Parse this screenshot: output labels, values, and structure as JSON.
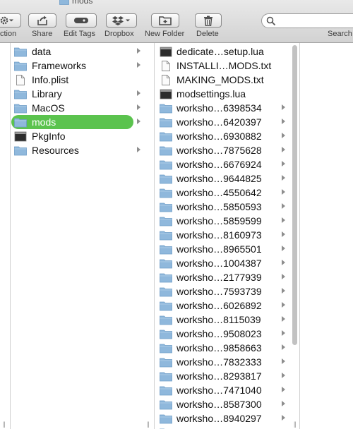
{
  "window": {
    "title": "mods"
  },
  "toolbar": {
    "action_label": "ction",
    "share_label": "Share",
    "edit_tags_label": "Edit Tags",
    "dropbox_label": "Dropbox",
    "new_folder_label": "New Folder",
    "delete_label": "Delete",
    "search_label": "Search",
    "search_placeholder": ""
  },
  "column2": {
    "items": [
      {
        "label": "data",
        "type": "folder",
        "has_children": true
      },
      {
        "label": "Frameworks",
        "type": "folder",
        "has_children": true
      },
      {
        "label": "Info.plist",
        "type": "document",
        "has_children": false
      },
      {
        "label": "Library",
        "type": "folder",
        "has_children": true
      },
      {
        "label": "MacOS",
        "type": "folder",
        "has_children": true
      },
      {
        "label": "mods",
        "type": "folder",
        "has_children": true,
        "selected": true
      },
      {
        "label": "PkgInfo",
        "type": "exec",
        "has_children": false
      },
      {
        "label": "Resources",
        "type": "folder",
        "has_children": true
      }
    ]
  },
  "column3": {
    "items": [
      {
        "label": "dedicate…setup.lua",
        "type": "exec",
        "has_children": false
      },
      {
        "label": "INSTALLI…MODS.txt",
        "type": "document",
        "has_children": false
      },
      {
        "label": "MAKING_MODS.txt",
        "type": "document",
        "has_children": false
      },
      {
        "label": "modsettings.lua",
        "type": "exec",
        "has_children": false
      },
      {
        "label": "worksho…6398534",
        "type": "folder",
        "has_children": true
      },
      {
        "label": "worksho…6420397",
        "type": "folder",
        "has_children": true
      },
      {
        "label": "worksho…6930882",
        "type": "folder",
        "has_children": true
      },
      {
        "label": "worksho…7875628",
        "type": "folder",
        "has_children": true
      },
      {
        "label": "worksho…6676924",
        "type": "folder",
        "has_children": true
      },
      {
        "label": "worksho…9644825",
        "type": "folder",
        "has_children": true
      },
      {
        "label": "worksho…4550642",
        "type": "folder",
        "has_children": true
      },
      {
        "label": "worksho…5850593",
        "type": "folder",
        "has_children": true
      },
      {
        "label": "worksho…5859599",
        "type": "folder",
        "has_children": true
      },
      {
        "label": "worksho…8160973",
        "type": "folder",
        "has_children": true
      },
      {
        "label": "worksho…8965501",
        "type": "folder",
        "has_children": true
      },
      {
        "label": "worksho…1004387",
        "type": "folder",
        "has_children": true
      },
      {
        "label": "worksho…2177939",
        "type": "folder",
        "has_children": true
      },
      {
        "label": "worksho…7593739",
        "type": "folder",
        "has_children": true
      },
      {
        "label": "worksho…6026892",
        "type": "folder",
        "has_children": true
      },
      {
        "label": "worksho…8115039",
        "type": "folder",
        "has_children": true
      },
      {
        "label": "worksho…9508023",
        "type": "folder",
        "has_children": true
      },
      {
        "label": "worksho…9858663",
        "type": "folder",
        "has_children": true
      },
      {
        "label": "worksho…7832333",
        "type": "folder",
        "has_children": true
      },
      {
        "label": "worksho…8293817",
        "type": "folder",
        "has_children": true
      },
      {
        "label": "worksho…7471040",
        "type": "folder",
        "has_children": true
      },
      {
        "label": "worksho…8587300",
        "type": "folder",
        "has_children": true
      },
      {
        "label": "worksho…8940297",
        "type": "folder",
        "has_children": true
      },
      {
        "label": "",
        "type": "folder",
        "has_children": true
      }
    ]
  },
  "colors": {
    "selection": "#5bc34e",
    "folder": "#8fb8dc",
    "folder_dark": "#6d9cc6"
  }
}
